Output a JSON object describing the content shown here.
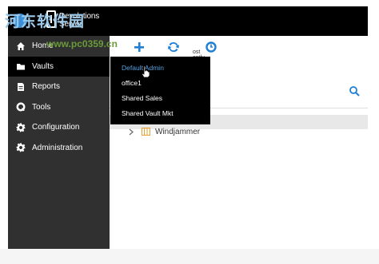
{
  "app": {
    "name": "Devolutions\nServer"
  },
  "sidebar": {
    "items": [
      {
        "label": "Home",
        "icon": "home-icon",
        "active": false
      },
      {
        "label": "Vaults",
        "icon": "vault-icon",
        "active": true
      },
      {
        "label": "Reports",
        "icon": "report-icon",
        "active": false
      },
      {
        "label": "Tools",
        "icon": "tools-icon",
        "active": false
      },
      {
        "label": "Configuration",
        "icon": "gear-icon",
        "active": false
      },
      {
        "label": "Administration",
        "icon": "admin-gear-icon",
        "active": false
      }
    ]
  },
  "toolbar": {
    "add_icon": "add-icon",
    "refresh_icon": "refresh-icon",
    "recent_icon": "recent-icon",
    "recent_label": "ost\nently\ned"
  },
  "vault_dropdown": {
    "items": [
      "Default Admin",
      "office1",
      "Shared Sales",
      "Shared Vault Mkt"
    ],
    "highlighted": "Default Admin"
  },
  "tree": {
    "items": [
      {
        "label": "Windjammer",
        "icon": "folder-icon"
      }
    ]
  },
  "watermark": {
    "text": "河东软件园",
    "url": "www.pc0359.cn"
  },
  "colors": {
    "accent": "#1e7fd4",
    "sidebar_bg": "#303030",
    "topbar_bg": "#000000",
    "highlight_text": "#57a3e0",
    "folder": "#e8a030"
  }
}
